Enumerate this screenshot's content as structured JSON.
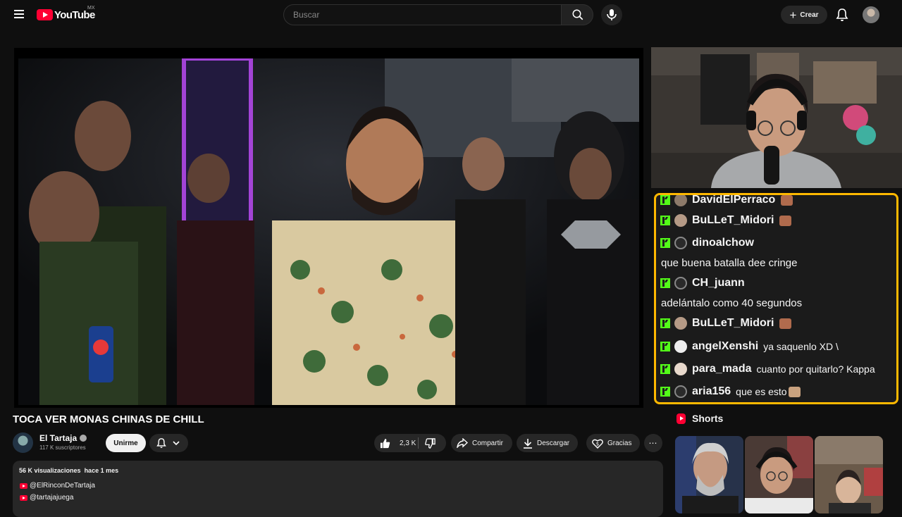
{
  "header": {
    "logo_text": "YouTube",
    "country": "MX",
    "search_placeholder": "Buscar",
    "create_label": "Crear"
  },
  "video": {
    "title": "TOCA VER MONAS CHINAS DE CHILL"
  },
  "channel": {
    "name": "El Tartaja",
    "subscribers": "117 K suscriptores",
    "join_label": "Unirme"
  },
  "actions": {
    "likes": "2,3 K",
    "share": "Compartir",
    "download": "Descargar",
    "thanks": "Gracias"
  },
  "description": {
    "views": "56 K visualizaciones",
    "age": "hace 1 mes",
    "links": [
      "@ElRinconDeTartaja",
      "@tartajajuega"
    ]
  },
  "chat": {
    "messages": [
      {
        "user": "DavidElPerraco",
        "text": "",
        "emote": true
      },
      {
        "user": "BuLLeT_Midori",
        "text": "",
        "emote": true
      },
      {
        "user": "dinoalchow",
        "text": ""
      },
      {
        "line": "que buena batalla dee cringe"
      },
      {
        "user": "CH_juann",
        "text": ""
      },
      {
        "line": "adelántalo como 40 segundos"
      },
      {
        "user": "BuLLeT_Midori",
        "text": "",
        "emote": true
      },
      {
        "user": "angelXenshi",
        "text": "ya saquenlo XD \\"
      },
      {
        "user": "para_mada",
        "text": "cuanto por quitarlo? Kappa"
      },
      {
        "user": "aria156",
        "text": "que es esto",
        "emote": true
      }
    ]
  },
  "shorts": {
    "heading": "Shorts"
  },
  "colors": {
    "background": "#0f0f0f",
    "chat_border": "#ffb800",
    "kick_green": "#53fc18",
    "youtube_red": "#ff0033"
  }
}
